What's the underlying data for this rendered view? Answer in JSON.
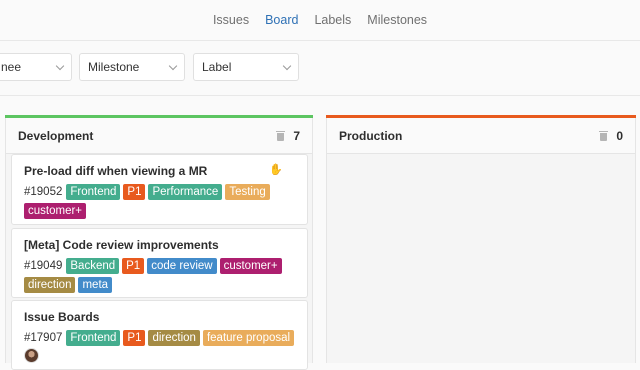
{
  "nav": {
    "tabs": [
      {
        "label": "Issues"
      },
      {
        "label": "Board"
      },
      {
        "label": "Labels"
      },
      {
        "label": "Milestones"
      }
    ],
    "active_tab": "Board"
  },
  "filters": {
    "assignee": "nee",
    "milestone": "Milestone",
    "label": "Label"
  },
  "boards": [
    {
      "title": "Development",
      "count": "7",
      "color": "#5cc561",
      "cards": [
        {
          "title": "Pre-load diff when viewing a MR",
          "number": "#19052",
          "labels": [
            {
              "text": "Frontend",
              "color": "#44ad8e"
            },
            {
              "text": "P1",
              "color": "#e85a1e"
            },
            {
              "text": "Performance",
              "color": "#44ad8e"
            },
            {
              "text": "Testing",
              "color": "#e9ac5b"
            },
            {
              "text": "customer+",
              "color": "#ad1f6f"
            }
          ]
        },
        {
          "title": "[Meta] Code review improvements",
          "number": "#19049",
          "labels": [
            {
              "text": "Backend",
              "color": "#44ad8e"
            },
            {
              "text": "P1",
              "color": "#e85a1e"
            },
            {
              "text": "code review",
              "color": "#428bca"
            },
            {
              "text": "customer+",
              "color": "#ad1f6f"
            },
            {
              "text": "direction",
              "color": "#a58b44"
            },
            {
              "text": "meta",
              "color": "#428bca"
            }
          ]
        },
        {
          "title": "Issue Boards",
          "number": "#17907",
          "labels": [
            {
              "text": "Frontend",
              "color": "#44ad8e"
            },
            {
              "text": "P1",
              "color": "#e85a1e"
            },
            {
              "text": "direction",
              "color": "#a58b44"
            },
            {
              "text": "feature proposal",
              "color": "#e9ac5b"
            }
          ]
        }
      ]
    },
    {
      "title": "Production",
      "count": "0",
      "color": "#e85a1e",
      "cards": []
    }
  ],
  "colors": {
    "active_tab": "#2f71b5"
  }
}
